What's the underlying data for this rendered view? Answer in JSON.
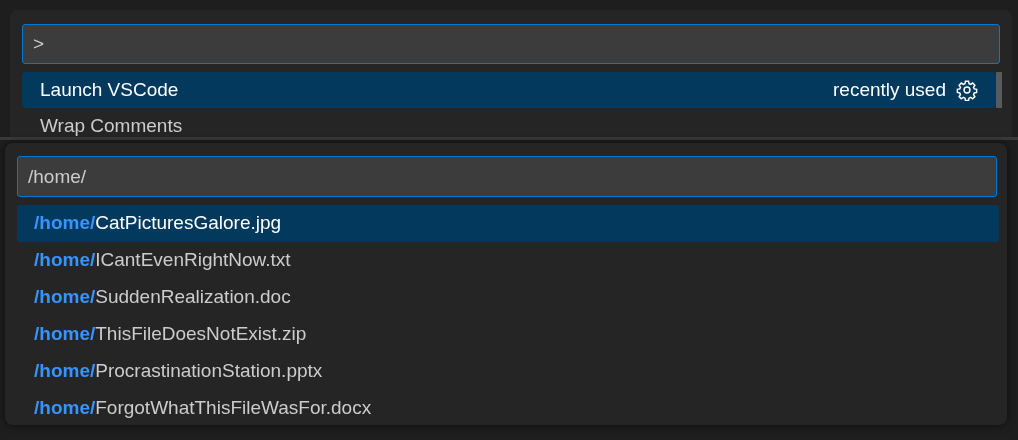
{
  "command_palette": {
    "input_value": ">",
    "items": [
      {
        "label": "Launch VSCode",
        "selected": true,
        "detail": "recently used"
      },
      {
        "label": "Wrap Comments",
        "selected": false
      }
    ]
  },
  "file_picker": {
    "input_value": "/home/",
    "items": [
      {
        "highlight": "/home/",
        "rest": "CatPicturesGalore.jpg",
        "selected": true
      },
      {
        "highlight": "/home/",
        "rest": "ICantEvenRightNow.txt",
        "selected": false
      },
      {
        "highlight": "/home/",
        "rest": "SuddenRealization.doc",
        "selected": false
      },
      {
        "highlight": "/home/",
        "rest": "ThisFileDoesNotExist.zip",
        "selected": false
      },
      {
        "highlight": "/home/",
        "rest": "ProcrastinationStation.pptx",
        "selected": false
      },
      {
        "highlight": "/home/",
        "rest": "ForgotWhatThisFileWasFor.docx",
        "selected": false
      }
    ]
  }
}
